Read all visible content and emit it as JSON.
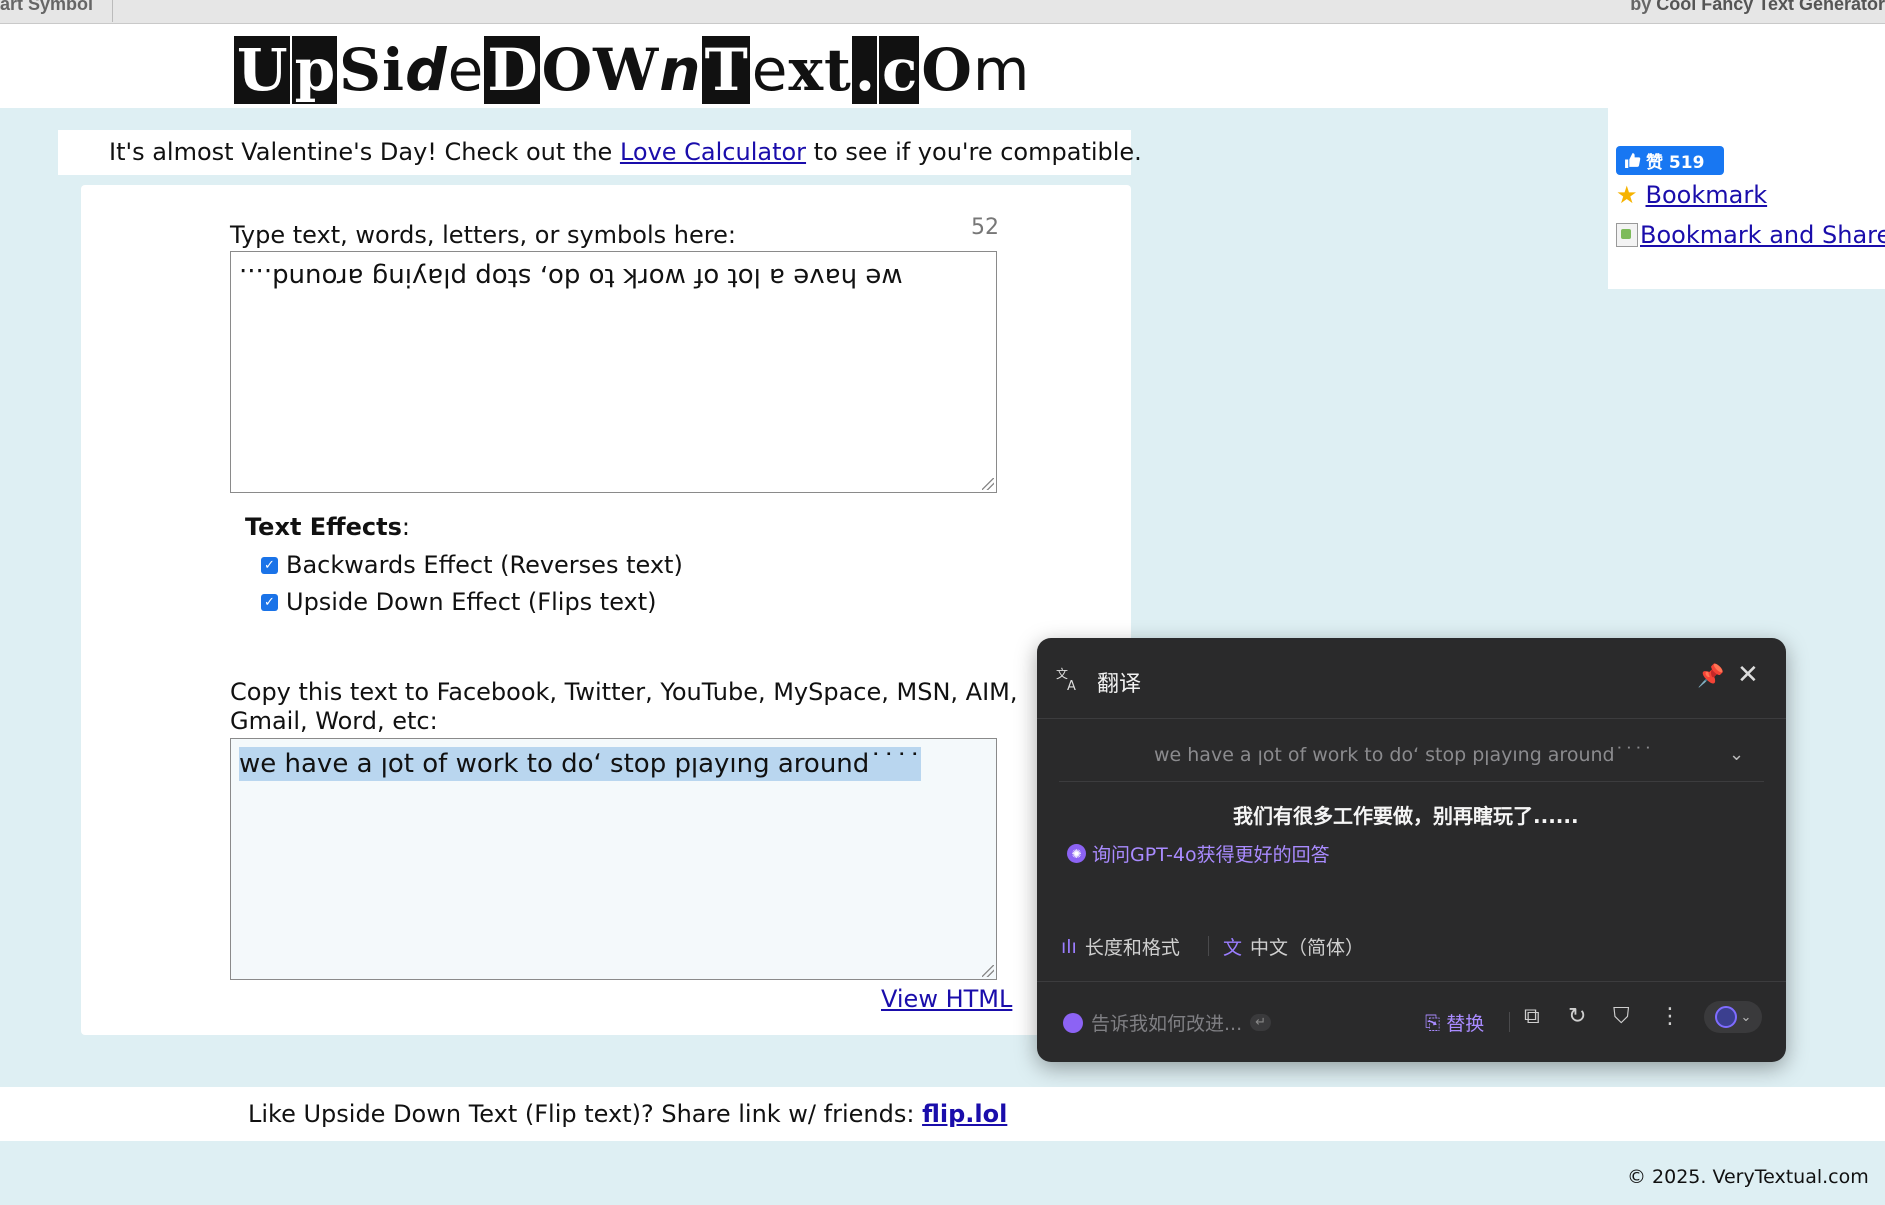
{
  "topbar": {
    "left_text": "art Symbol",
    "right_prefix": "by ",
    "right_link": "Cool Fancy Text Generator"
  },
  "logo": {
    "parts": [
      "U",
      "p",
      "S",
      "i",
      "d",
      "e",
      "D",
      "O",
      "W",
      "n",
      "T",
      "e",
      "x",
      "t",
      ".",
      "c",
      "O",
      "m"
    ]
  },
  "announcement": {
    "before": "It's almost Valentine's Day! Check out the ",
    "link": "Love Calculator",
    "after": " to see if you're compatible."
  },
  "sidebar": {
    "like_count": "赞 519",
    "bookmark_label": "Bookmark",
    "share_label": "Bookmark and Share"
  },
  "editor": {
    "input_label": "Type text, words, letters, or symbols here:",
    "char_count": "52",
    "input_value": "we have a lot of work to do, stop playing around....",
    "effects_title": "Text Effects",
    "effects_colon": ":",
    "effects": [
      {
        "label": "Backwards Effect (Reverses text)",
        "checked": true
      },
      {
        "label": "Upside Down Effect (Flips text)",
        "checked": true
      }
    ],
    "copy_label": "Copy this text to Facebook, Twitter, YouTube, MySpace, MSN, AIM, Gmail, Word, etc:",
    "output_value": "we have a ןot of work to doʻ stop pןayıng around˙˙˙˙",
    "view_html": "View HTML"
  },
  "translator": {
    "title": "翻译",
    "source_text": "we have a ןot of work to doʻ stop pןayıng around˙˙˙˙",
    "result_text": "我们有很多工作要做，别再瞎玩了......",
    "ask_gpt": "询问GPT-4o获得更好的回答",
    "option_length": "长度和格式",
    "option_language": "中文（简体）",
    "feedback_placeholder": "告诉我如何改进...",
    "enter_key": "↵",
    "replace": "替换"
  },
  "footer": {
    "share_prefix": "Like Upside Down Text (Flip text)? Share link w/ friends: ",
    "share_link": "flip.lol",
    "copyright": "© 2025. VeryTextual.com"
  }
}
